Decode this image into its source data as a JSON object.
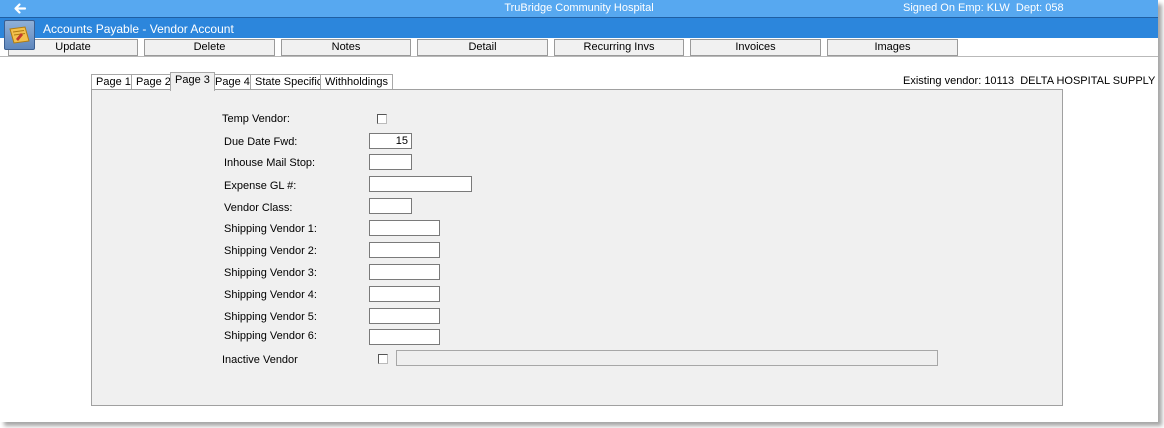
{
  "titlebar": {
    "title": "TruBridge Community Hospital",
    "signed_on": "Signed On Emp: KLW  Dept: 058"
  },
  "header": {
    "module_title": "Accounts Payable - Vendor Account"
  },
  "toolbar": {
    "buttons": [
      "Update",
      "Delete",
      "Notes",
      "Detail",
      "Recurring Invs",
      "Invoices",
      "Images"
    ]
  },
  "tabs": [
    "Page 1",
    "Page 2",
    "Page 3",
    "Page 4",
    "State Specific",
    "Withholdings"
  ],
  "active_tab": "Page 3",
  "existing_vendor": "Existing vendor: 10113  DELTA HOSPITAL SUPPLY",
  "form": {
    "temp_vendor_label": "Temp Vendor:",
    "temp_vendor_checked": false,
    "due_date_fwd_label": "Due Date Fwd:",
    "due_date_fwd_value": "15",
    "inhouse_mail_stop_label": "Inhouse Mail Stop:",
    "inhouse_mail_stop_value": "",
    "expense_gl_label": "Expense GL #:",
    "expense_gl_value": "",
    "vendor_class_label": "Vendor Class:",
    "vendor_class_value": "",
    "shipping_vendors": [
      {
        "label": "Shipping Vendor 1:",
        "value": ""
      },
      {
        "label": "Shipping Vendor 2:",
        "value": ""
      },
      {
        "label": "Shipping Vendor 3:",
        "value": ""
      },
      {
        "label": "Shipping Vendor 4:",
        "value": ""
      },
      {
        "label": "Shipping Vendor 5:",
        "value": ""
      },
      {
        "label": "Shipping Vendor 6:",
        "value": ""
      }
    ],
    "inactive_vendor_label": "Inactive Vendor",
    "inactive_vendor_checked": false,
    "inactive_vendor_value": ""
  },
  "colors": {
    "titlebar": "#57a8f0",
    "menubar": "#2c86dc",
    "panel": "#f0f0f0"
  },
  "icons": [
    "back-arrow-icon",
    "accounts-payable-app-icon"
  ]
}
